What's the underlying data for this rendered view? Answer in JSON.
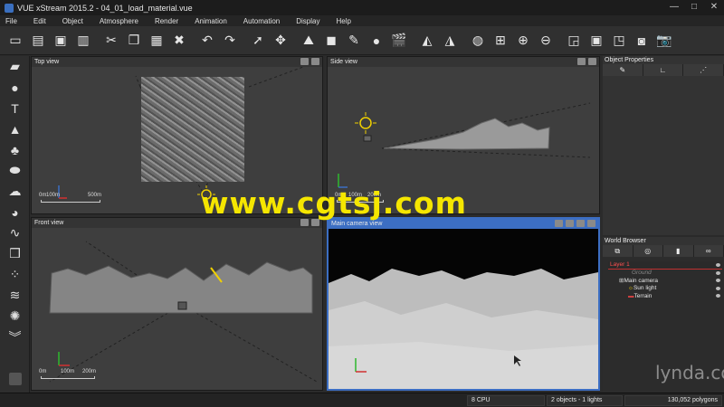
{
  "window": {
    "title": "VUE xStream 2015.2 - 04_01_load_material.vue",
    "minimize": "—",
    "maximize": "□",
    "close": "✕"
  },
  "menu": [
    "File",
    "Edit",
    "Object",
    "Atmosphere",
    "Render",
    "Animation",
    "Automation",
    "Display",
    "Help"
  ],
  "toolbar_icons": [
    "new-file-icon",
    "open-file-icon",
    "save-icon",
    "save-as-icon",
    "cut-icon",
    "copy-icon",
    "paste-icon",
    "delete-icon",
    "undo-icon",
    "redo-icon",
    "select-icon",
    "move-icon",
    "landscape-icon",
    "cube-icon",
    "material-icon",
    "color-icon",
    "render-icon",
    "mirror-icon",
    "split-icon",
    "globe-icon",
    "transform-icon",
    "zoom-in-icon",
    "zoom-out-icon",
    "fit-icon",
    "layout-icon",
    "view-icon",
    "camera-icon",
    "snapshot-icon"
  ],
  "toolbar_glyphs": [
    "▭",
    "▤",
    "▣",
    "▥",
    "✂",
    "❐",
    "▦",
    "✖",
    "↶",
    "↷",
    "➚",
    "✥",
    "⛰",
    "◼",
    "✎",
    "●",
    "🎬",
    "◭",
    "◮",
    "◍",
    "⊞",
    "⊕",
    "⊖",
    "◲",
    "▣",
    "◳",
    "◙",
    "📷"
  ],
  "left_tools": [
    {
      "icon": "terrain-tool-icon",
      "glyph": "▰"
    },
    {
      "icon": "sphere-tool-icon",
      "glyph": "●"
    },
    {
      "icon": "text-tool-icon",
      "glyph": "T"
    },
    {
      "icon": "mountain-tool-icon",
      "glyph": "▲"
    },
    {
      "icon": "tree-tool-icon",
      "glyph": "♣"
    },
    {
      "icon": "rock-tool-icon",
      "glyph": "⬬"
    },
    {
      "icon": "cloud-tool-icon",
      "glyph": "☁"
    },
    {
      "icon": "planet-tool-icon",
      "glyph": "◕"
    },
    {
      "icon": "curve-tool-icon",
      "glyph": "∿"
    },
    {
      "icon": "object-tool-icon",
      "glyph": "❒"
    },
    {
      "icon": "particles-tool-icon",
      "glyph": "⁘"
    },
    {
      "icon": "tornado-tool-icon",
      "glyph": "≋"
    },
    {
      "icon": "light-tool-icon",
      "glyph": "✺"
    },
    {
      "icon": "expand-tools-icon",
      "glyph": "︾"
    }
  ],
  "viewports": {
    "top": {
      "title": "Top view",
      "scale": {
        "zero": "0m",
        "a": "100m",
        "b": "500m"
      }
    },
    "side": {
      "title": "Side view",
      "scale": {
        "zero": "0m",
        "a": "100m",
        "b": "200m"
      }
    },
    "front": {
      "title": "Front view",
      "scale": {
        "zero": "0m",
        "a": "100m",
        "b": "200m"
      }
    },
    "camera": {
      "title": "Main camera view"
    }
  },
  "object_properties": {
    "title": "Object Properties"
  },
  "world_browser": {
    "title": "World Browser",
    "items": [
      {
        "label": "Layer 1"
      },
      {
        "label": "Ground"
      },
      {
        "label": "Main camera"
      },
      {
        "label": "Sun light"
      },
      {
        "label": "Terrain"
      }
    ]
  },
  "status": {
    "cpu": "8 CPU",
    "objects": "2 objects - 1 lights",
    "polygons": "130,052 polygons"
  },
  "watermark": "www.cgtsj.com",
  "brand": "lynda.com",
  "colors": {
    "accent": "#3c6ec3",
    "watermark": "#f5e600"
  }
}
